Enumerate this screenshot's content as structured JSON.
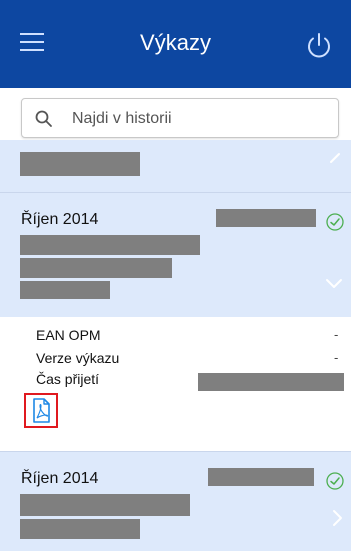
{
  "app": {
    "title": "Výkazy",
    "menu_icon": "hamburger-icon",
    "power_icon": "power-icon"
  },
  "search": {
    "placeholder": "Najdi v historii",
    "value": "",
    "icon": "search-icon"
  },
  "reports": [
    {
      "month": "Říjen 2014",
      "status_icon": "check-circle-icon",
      "chevron": "chevron-down-icon",
      "expanded": true
    },
    {
      "month": "Říjen 2014",
      "status_icon": "check-circle-icon",
      "chevron": "chevron-right-icon",
      "expanded": false
    }
  ],
  "details": {
    "ean_label": "EAN OPM",
    "ean_value": "-",
    "version_label": "Verze výkazu",
    "version_value": "-",
    "received_label": "Čas přijetí",
    "attachment_icon": "pdf-icon"
  },
  "colors": {
    "appbar": "#0d47a1",
    "row_background": "#dde9fb",
    "check": "#4caf50",
    "highlight_border": "#e0191f",
    "pdf": "#1e88e5"
  }
}
